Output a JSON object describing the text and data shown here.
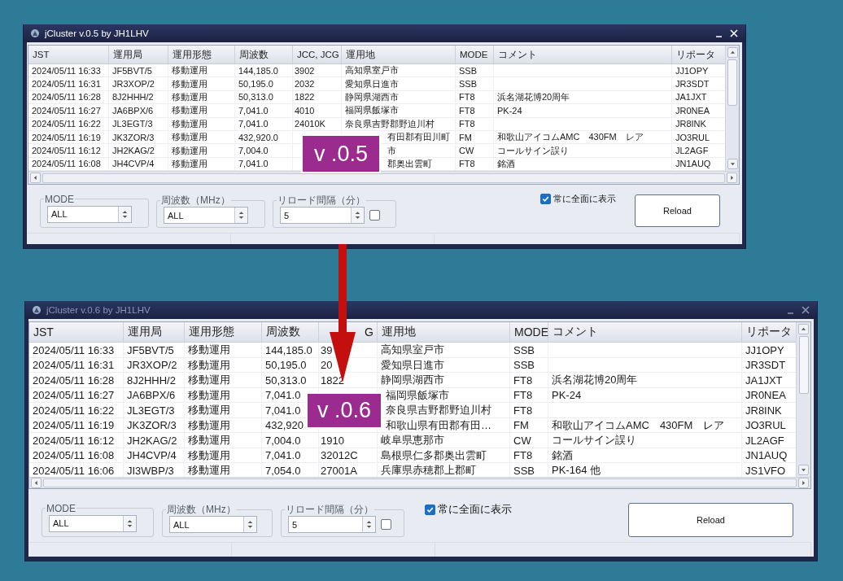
{
  "windows": [
    {
      "title": "jCluster v.0.5 by JH1LHV",
      "active": true,
      "version_label": "v .0.5",
      "table": {
        "columns": [
          {
            "label": "JST"
          },
          {
            "label": "運用局"
          },
          {
            "label": "運用形態"
          },
          {
            "label": "周波数"
          },
          {
            "label": "JCC, JCG"
          },
          {
            "label": "運用地"
          },
          {
            "label": "MODE"
          },
          {
            "label": "コメント"
          },
          {
            "label": "リポータ"
          }
        ],
        "rows": [
          {
            "covered": false,
            "cells": [
              "2024/05/11 16:33",
              "JF5BVT/5",
              "移動運用",
              "144,185.0",
              "3902",
              "高知県室戸市",
              "SSB",
              null,
              "JJ1OPY"
            ]
          },
          {
            "covered": false,
            "cells": [
              "2024/05/11 16:31",
              "JR3XOP/2",
              "移動運用",
              "50,195.0",
              "2032",
              "愛知県日進市",
              "SSB",
              null,
              "JR3SDT"
            ]
          },
          {
            "covered": false,
            "cells": [
              "2024/05/11 16:28",
              "8J2HHH/2",
              "移動運用",
              "50,313.0",
              "1822",
              "静岡県湖西市",
              "FT8",
              "浜名湖花博20周年",
              "JA1JXT"
            ]
          },
          {
            "covered": false,
            "cells": [
              "2024/05/11 16:27",
              "JA6BPX/6",
              "移動運用",
              "7,041.0",
              "4010",
              "福岡県飯塚市",
              "FT8",
              "PK-24",
              "JR0NEA"
            ]
          },
          {
            "covered": false,
            "cells": [
              "2024/05/11 16:22",
              "JL3EGT/3",
              "移動運用",
              "7,041.0",
              "24010K",
              "奈良県吉野郡野迫川村",
              "FT8",
              null,
              "JR8INK"
            ]
          },
          {
            "covered": true,
            "cells": [
              "2024/05/11 16:19",
              "JK3ZOR/3",
              "移動運用",
              "432,920.0",
              null,
              "有田郡有田川町",
              "FM",
              "和歌山アイコムAMC　430FM　レア",
              "JO3RUL"
            ]
          },
          {
            "covered": true,
            "cells": [
              "2024/05/11 16:12",
              "JH2KAG/2",
              "移動運用",
              "7,004.0",
              null,
              "市",
              "CW",
              "コールサイン誤り",
              "JL2AGF"
            ]
          },
          {
            "covered": true,
            "cells": [
              "2024/05/11 16:08",
              "JH4CVP/4",
              "移動運用",
              "7,041.0",
              null,
              "郡奥出雲町",
              "FT8",
              "銘酒",
              "JN1AUQ"
            ]
          }
        ]
      },
      "controls": {
        "groups": [
          {
            "label": "MODE",
            "value": "ALL"
          },
          {
            "label": "周波数（MHz）",
            "value": "ALL"
          },
          {
            "label": "リロード間隔（分）",
            "value": "5",
            "checkbox": {
              "checked": false
            }
          }
        ],
        "topmost": {
          "label": "常に全面に表示",
          "checked": true
        },
        "reload_button": "Reload"
      }
    },
    {
      "title": "jCluster v.0.6 by JH1LHV",
      "active": false,
      "version_label": "v .0.6",
      "table": {
        "columns": [
          {
            "label": "JST"
          },
          {
            "label": "運用局"
          },
          {
            "label": "運用形態"
          },
          {
            "label": "周波数"
          },
          {
            "label": "G"
          },
          {
            "label": "運用地"
          },
          {
            "label": "MODE"
          },
          {
            "label": "コメント"
          },
          {
            "label": "リポータ"
          }
        ],
        "rows": [
          {
            "covered": false,
            "cells": [
              "2024/05/11 16:33",
              "JF5BVT/5",
              "移動運用",
              "144,185.0",
              "39",
              "高知県室戸市",
              "SSB",
              null,
              "JJ1OPY"
            ]
          },
          {
            "covered": false,
            "cells": [
              "2024/05/11 16:31",
              "JR3XOP/2",
              "移動運用",
              "50,195.0",
              "20",
              "愛知県日進市",
              "SSB",
              null,
              "JR3SDT"
            ]
          },
          {
            "covered": false,
            "cells": [
              "2024/05/11 16:28",
              "8J2HHH/2",
              "移動運用",
              "50,313.0",
              "1822",
              "静岡県湖西市",
              "FT8",
              "浜名湖花博20周年",
              "JA1JXT"
            ]
          },
          {
            "covered": true,
            "cells": [
              "2024/05/11 16:27",
              "JA6BPX/6",
              "移動運用",
              "7,041.0",
              null,
              "福岡県飯塚市",
              "FT8",
              "PK-24",
              "JR0NEA"
            ]
          },
          {
            "covered": true,
            "cells": [
              "2024/05/11 16:22",
              "JL3EGT/3",
              "移動運用",
              "7,041.0",
              null,
              "奈良県吉野郡野迫川村",
              "FT8",
              null,
              "JR8INK"
            ]
          },
          {
            "covered": true,
            "cells": [
              "2024/05/11 16:19",
              "JK3ZOR/3",
              "移動運用",
              "432,920",
              null,
              "和歌山県有田郡有田…",
              "FM",
              "和歌山アイコムAMC　430FM　レア",
              "JO3RUL"
            ]
          },
          {
            "covered": false,
            "cells": [
              "2024/05/11 16:12",
              "JH2KAG/2",
              "移動運用",
              "7,004.0",
              "1910",
              "岐阜県恵那市",
              "CW",
              "コールサイン誤り",
              "JL2AGF"
            ]
          },
          {
            "covered": false,
            "cells": [
              "2024/05/11 16:08",
              "JH4CVP/4",
              "移動運用",
              "7,041.0",
              "32012C",
              "島根県仁多郡奥出雲町",
              "FT8",
              "銘酒",
              "JN1AUQ"
            ]
          },
          {
            "covered": false,
            "cells": [
              "2024/05/11 16:06",
              "JI3WBP/3",
              "移動運用",
              "7,054.0",
              "27001A",
              "兵庫県赤穂郡上郡町",
              "SSB",
              "PK-164 他",
              "JS1VFO"
            ]
          }
        ]
      },
      "controls": {
        "groups": [
          {
            "label": "MODE",
            "value": "ALL"
          },
          {
            "label": "周波数（MHz）",
            "value": "ALL"
          },
          {
            "label": "リロード間隔（分）",
            "value": "5",
            "checkbox": {
              "checked": false
            }
          }
        ],
        "topmost": {
          "label": "常に全面に表示",
          "checked": true
        },
        "reload_button": "Reload"
      }
    }
  ]
}
